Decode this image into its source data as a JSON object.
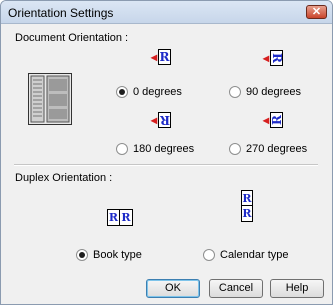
{
  "window": {
    "title": "Orientation Settings",
    "close_label": "✕"
  },
  "document_orientation": {
    "label": "Document Orientation :",
    "options": [
      {
        "label": "0 degrees",
        "selected": true
      },
      {
        "label": "90 degrees",
        "selected": false
      },
      {
        "label": "180 degrees",
        "selected": false
      },
      {
        "label": "270 degrees",
        "selected": false
      }
    ],
    "icon_letter": "R"
  },
  "duplex_orientation": {
    "label": "Duplex Orientation :",
    "options": [
      {
        "label": "Book type",
        "selected": true
      },
      {
        "label": "Calendar type",
        "selected": false
      }
    ]
  },
  "buttons": {
    "ok": "OK",
    "cancel": "Cancel",
    "help": "Help"
  },
  "colors": {
    "accent": "#1e2bc8",
    "arrow": "#d61f1f",
    "page_border": "#000000"
  }
}
